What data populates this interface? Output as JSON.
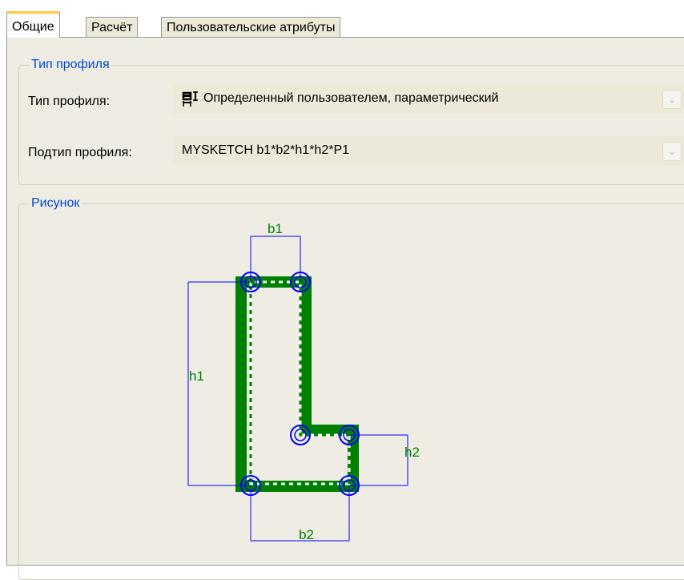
{
  "tabs": [
    {
      "label": "Общие",
      "active": true
    },
    {
      "label": "Расчёт",
      "active": false
    },
    {
      "label": "Пользовательские атрибуты",
      "active": false
    }
  ],
  "profile_group": {
    "title": "Тип профиля",
    "type_label": "Тип профиля:",
    "type_value": "Определенный пользователем, параметрический",
    "type_icon": "parametric-profile-icon",
    "subtype_label": "Подтип профиля:",
    "subtype_value": "MYSKETCH  b1*b2*h1*h2*P1"
  },
  "picture_group": {
    "title": "Рисунок",
    "dimensions": {
      "b1": "b1",
      "h1": "h1",
      "h2": "h2",
      "b2": "b2"
    }
  },
  "colors": {
    "accent_tab": "#ffc83c",
    "group_title": "#0046d5",
    "profile_fill": "#008000",
    "dimension_lines": "#0000ff",
    "panel_bg": "#efede3"
  }
}
